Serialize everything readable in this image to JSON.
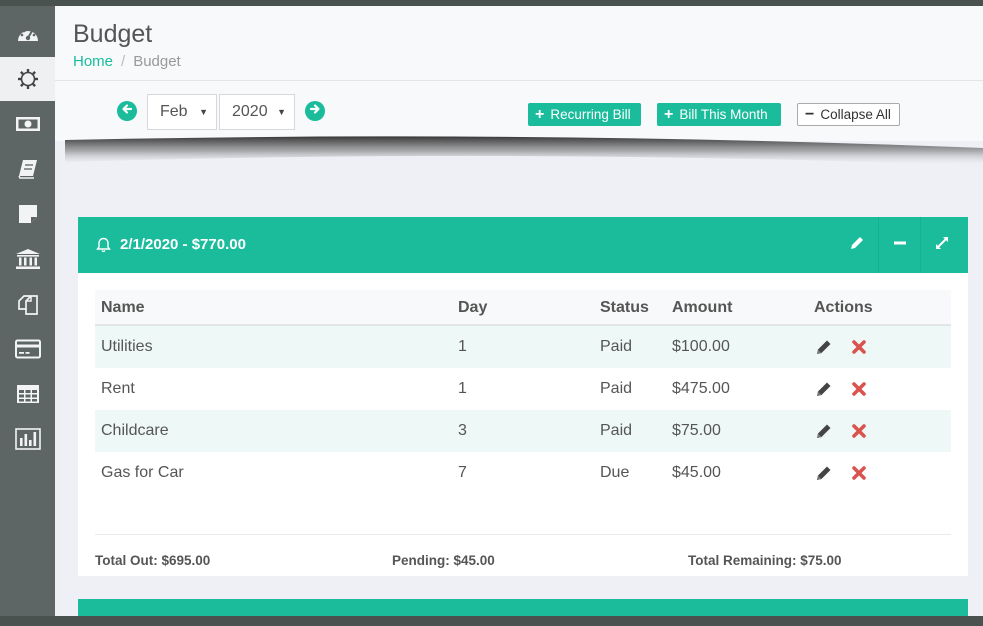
{
  "header": {
    "title": "Budget",
    "breadcrumb": {
      "home": "Home",
      "separator": "/",
      "current": "Budget"
    }
  },
  "sidebar": {
    "items": [
      {
        "icon": "speedometer-icon",
        "active": false
      },
      {
        "icon": "gear-icon",
        "active": true
      },
      {
        "icon": "money-bill-icon",
        "active": false
      },
      {
        "icon": "book-icon",
        "active": false
      },
      {
        "icon": "sticky-note-icon",
        "active": false
      },
      {
        "icon": "bank-icon",
        "active": false
      },
      {
        "icon": "copy-icon",
        "active": false
      },
      {
        "icon": "credit-card-icon",
        "active": false
      },
      {
        "icon": "table-icon",
        "active": false
      },
      {
        "icon": "bar-chart-icon",
        "active": false
      }
    ]
  },
  "toolbar": {
    "month": "Feb",
    "year": "2020",
    "recurring_label": "Recurring Bill",
    "bill_month_label": "Bill This Month",
    "collapse_label": "Collapse All"
  },
  "panel": {
    "title": "2/1/2020 - $770.00",
    "columns": {
      "name": "Name",
      "day": "Day",
      "status": "Status",
      "amount": "Amount",
      "actions": "Actions"
    },
    "rows": [
      {
        "name": "Utilities",
        "day": "1",
        "status": "Paid",
        "amount": "$100.00"
      },
      {
        "name": "Rent",
        "day": "1",
        "status": "Paid",
        "amount": "$475.00"
      },
      {
        "name": "Childcare",
        "day": "3",
        "status": "Paid",
        "amount": "$75.00"
      },
      {
        "name": "Gas for Car",
        "day": "7",
        "status": "Due",
        "amount": "$45.00"
      }
    ],
    "totals": {
      "total_out": "Total Out: $695.00",
      "pending": "Pending: $45.00",
      "remaining": "Total Remaining: $75.00"
    }
  },
  "colors": {
    "accent": "#1abc9c",
    "sidebar": "#5d6664",
    "delete": "#d9534f"
  }
}
